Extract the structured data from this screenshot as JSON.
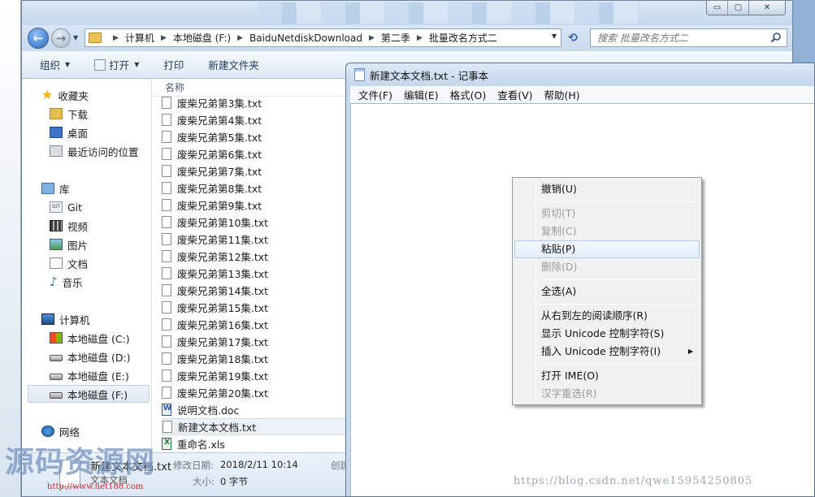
{
  "explorer": {
    "controls": {
      "minimize": "▭",
      "maximize": "▢",
      "close": "✕"
    },
    "address": {
      "crumbs": [
        "计算机",
        "本地磁盘 (F:)",
        "BaiduNetdiskDownload",
        "第二季",
        "批量改名方式二"
      ]
    },
    "search": {
      "placeholder": "搜索 批量改名方式二"
    },
    "toolbar": {
      "organize": "组织",
      "open": "打开",
      "print": "打印",
      "new_folder": "新建文件夹"
    },
    "nav": {
      "favorites": "收藏夹",
      "downloads": "下载",
      "desktop": "桌面",
      "recent": "最近访问的位置",
      "libraries": "库",
      "git": "Git",
      "videos": "视频",
      "pictures": "图片",
      "documents": "文档",
      "music": "音乐",
      "computer": "计算机",
      "drive_c": "本地磁盘 (C:)",
      "drive_d": "本地磁盘 (D:)",
      "drive_e": "本地磁盘 (E:)",
      "drive_f": "本地磁盘 (F:)",
      "network": "网络"
    },
    "column_name": "名称",
    "files": [
      "废柴兄弟第3集.txt",
      "废柴兄弟第4集.txt",
      "废柴兄弟第5集.txt",
      "废柴兄弟第6集.txt",
      "废柴兄弟第7集.txt",
      "废柴兄弟第8集.txt",
      "废柴兄弟第9集.txt",
      "废柴兄弟第10集.txt",
      "废柴兄弟第11集.txt",
      "废柴兄弟第12集.txt",
      "废柴兄弟第13集.txt",
      "废柴兄弟第14集.txt",
      "废柴兄弟第15集.txt",
      "废柴兄弟第16集.txt",
      "废柴兄弟第17集.txt",
      "废柴兄弟第18集.txt",
      "废柴兄弟第19集.txt",
      "废柴兄弟第20集.txt",
      "说明文档.doc",
      "新建文本文档.txt",
      "重命名.xls"
    ],
    "details": {
      "name": "新建文本文档.txt",
      "type": "文本文档",
      "modified_label": "修改日期:",
      "modified_value": "2018/2/11 10:14",
      "size_label": "大小:",
      "size_value": "0 字节",
      "created_label": "创建"
    }
  },
  "notepad": {
    "title": "新建文本文档.txt - 记事本",
    "menu": {
      "file": "文件(F)",
      "edit": "编辑(E)",
      "format": "格式(O)",
      "view": "查看(V)",
      "help": "帮助(H)"
    }
  },
  "context_menu": {
    "undo": "撤销(U)",
    "cut": "剪切(T)",
    "copy": "复制(C)",
    "paste": "粘贴(P)",
    "delete": "删除(D)",
    "select_all": "全选(A)",
    "rtl": "从右到左的阅读顺序(R)",
    "show_unicode": "显示 Unicode 控制字符(S)",
    "insert_unicode": "插入 Unicode 控制字符(I)",
    "open_ime": "打开 IME(O)",
    "reconversion": "汉字重选(R)"
  },
  "watermarks": {
    "site_cn": "源码资源网",
    "site_url": "http://www.net188.com",
    "blog": "https://blog.csdn.net/qwe15954250805"
  }
}
